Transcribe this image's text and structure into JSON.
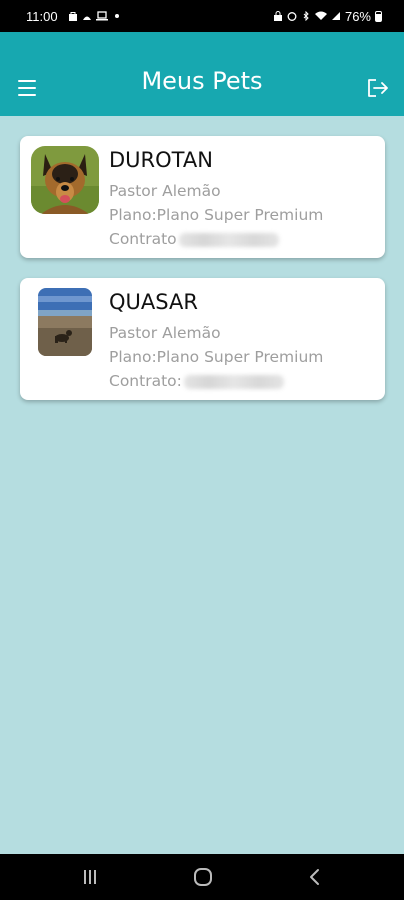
{
  "status_bar": {
    "time": "11:00",
    "battery": "76%"
  },
  "app_bar": {
    "title": "Meus Pets",
    "menu_icon": "menu-icon",
    "logout_icon": "logout-icon",
    "color": "#17a8b0"
  },
  "background_color": "#b5dde0",
  "pets": [
    {
      "name": "DUROTAN",
      "breed": "Pastor Alemão",
      "plan": "Plano:Plano Super Premium",
      "contract_label": "Contrato",
      "contract_value": "",
      "photo": "german-shepherd-photo"
    },
    {
      "name": "QUASAR",
      "breed": "Pastor Alemão",
      "plan": "Plano:Plano Super Premium",
      "contract_label": "Contrato:",
      "contract_value": "",
      "photo": "beach-dog-photo"
    }
  ],
  "nav_bar": {
    "recents_icon": "recents-icon",
    "home_icon": "home-icon",
    "back_icon": "back-icon"
  }
}
